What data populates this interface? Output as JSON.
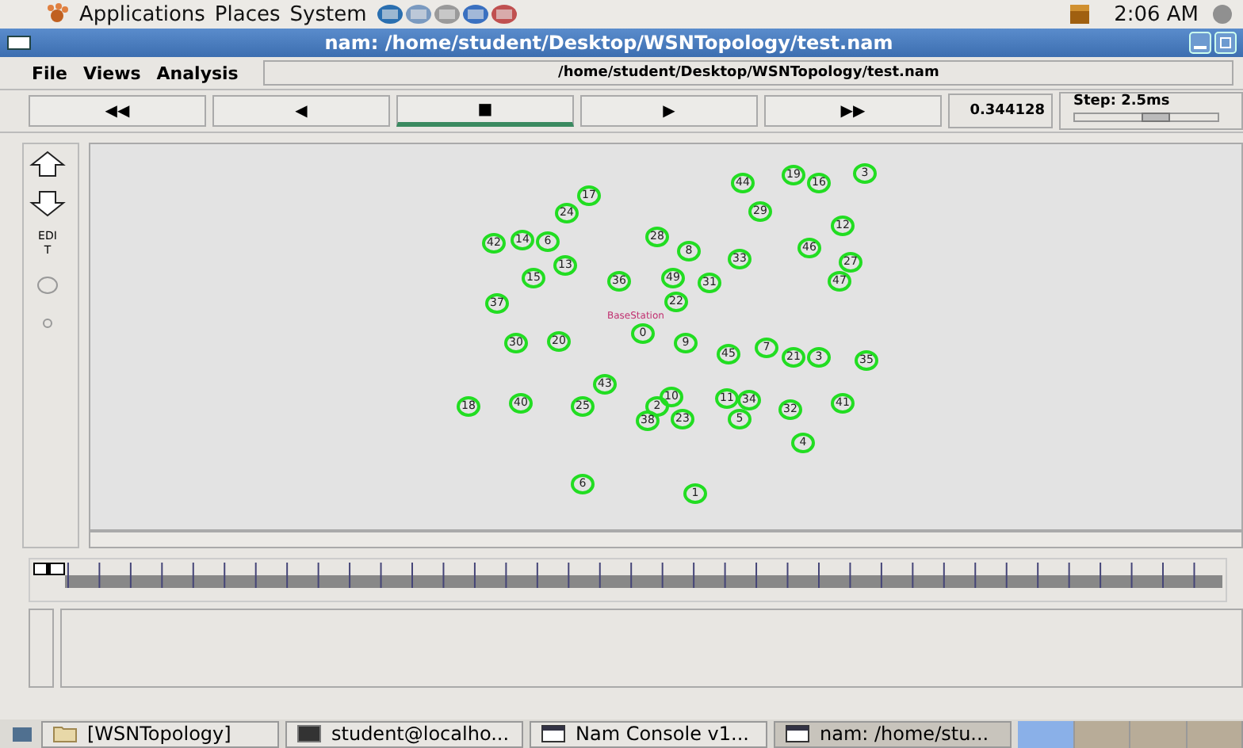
{
  "top_panel": {
    "menus": [
      "Applications",
      "Places",
      "System"
    ],
    "clock": "2:06 AM"
  },
  "window": {
    "title": "nam: /home/student/Desktop/WSNTopology/test.nam"
  },
  "menu": [
    "File",
    "Views",
    "Analysis"
  ],
  "file_path": "/home/student/Desktop/WSNTopology/test.nam",
  "controls": [
    {
      "symbol": "◀◀",
      "selected": false
    },
    {
      "symbol": "◀",
      "selected": false
    },
    {
      "symbol": "■",
      "selected": true
    },
    {
      "symbol": "▶",
      "selected": false
    },
    {
      "symbol": "▶▶",
      "selected": false
    }
  ],
  "time": "0.344128",
  "step": {
    "label": "Step: 2.5ms",
    "level": 0.55
  },
  "side_tools": [
    {
      "kind": "zoom-in"
    },
    {
      "kind": "zoom-out"
    },
    {
      "kind": "edit",
      "label": "EDIT"
    },
    {
      "kind": "circle"
    },
    {
      "kind": "dot"
    }
  ],
  "base_station": "BaseStation",
  "nodes": [
    {
      "label": "44"
    },
    {
      "label": "19"
    },
    {
      "label": "16"
    },
    {
      "label": "3"
    },
    {
      "label": "17"
    },
    {
      "label": "24"
    },
    {
      "label": "29"
    },
    {
      "label": "12"
    },
    {
      "label": "42"
    },
    {
      "label": "14"
    },
    {
      "label": "6"
    },
    {
      "label": "28"
    },
    {
      "label": "8"
    },
    {
      "label": "46"
    },
    {
      "label": "13"
    },
    {
      "label": "33"
    },
    {
      "label": "27"
    },
    {
      "label": "15"
    },
    {
      "label": "36"
    },
    {
      "label": "49"
    },
    {
      "label": "31"
    },
    {
      "label": "47"
    },
    {
      "label": "37"
    },
    {
      "label": "22"
    },
    {
      "label": "0"
    },
    {
      "label": "30"
    },
    {
      "label": "20"
    },
    {
      "label": "9"
    },
    {
      "label": "7"
    },
    {
      "label": "45"
    },
    {
      "label": "21"
    },
    {
      "label": "3"
    },
    {
      "label": "35"
    },
    {
      "label": "43"
    },
    {
      "label": "18"
    },
    {
      "label": "40"
    },
    {
      "label": "25"
    },
    {
      "label": "10"
    },
    {
      "label": "2"
    },
    {
      "label": "38"
    },
    {
      "label": "23"
    },
    {
      "label": "11"
    },
    {
      "label": "34"
    },
    {
      "label": "5"
    },
    {
      "label": "32"
    },
    {
      "label": "41"
    },
    {
      "label": "4"
    },
    {
      "label": "6"
    },
    {
      "label": "1"
    }
  ],
  "timeline": {
    "level": 0.0
  },
  "taskbar": [
    {
      "label": "[WSNTopology]",
      "kind": "folder",
      "selected": false
    },
    {
      "label": "student@localho...",
      "kind": "terminal",
      "selected": false
    },
    {
      "label": "Nam Console v1...",
      "kind": "window",
      "selected": false
    },
    {
      "label": "nam: /home/stu...",
      "kind": "window",
      "selected": true
    }
  ]
}
